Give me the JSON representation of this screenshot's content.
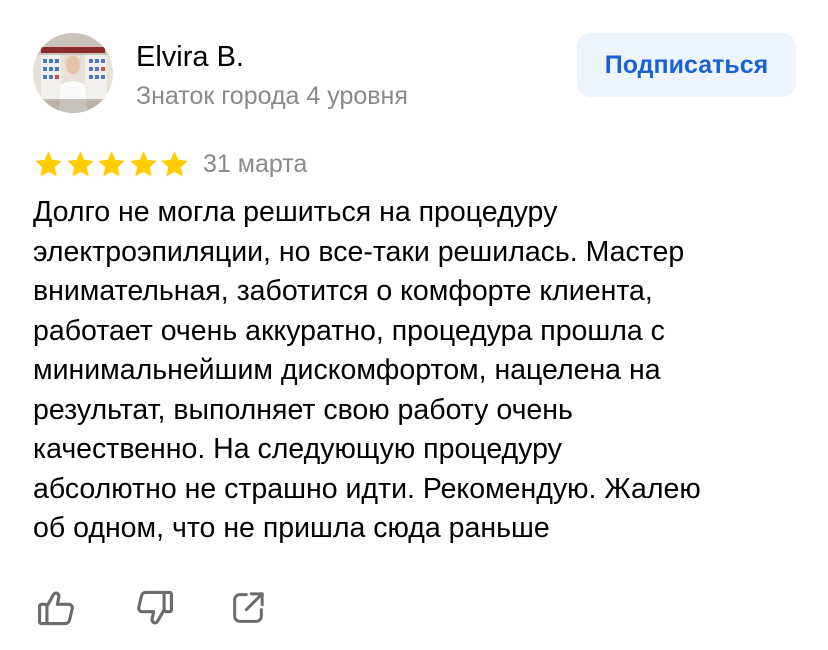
{
  "author": {
    "name": "Elvira B.",
    "level": "Знаток города 4 уровня"
  },
  "subscribe_label": "Подписаться",
  "rating": {
    "value": 5,
    "max": 5,
    "star_color": "#ffcc00"
  },
  "date": "31 марта",
  "review": {
    "lines": [
      "Долго не могла решиться на процедуру",
      "электроэпиляции, но все-таки решилась. Мастер",
      "внимательная, заботится о комфорте клиента,",
      "работает очень аккуратно, процедура прошла с",
      "минимальнейшим дискомфортом, нацелена на",
      "результат, выполняет свою работу очень",
      "качественно. На следующую процедуру",
      "абсолютно не страшно идти. Рекомендую. Жалею",
      "об одном, что не пришла сюда раньше"
    ]
  },
  "actions": {
    "like_icon": "thumbs-up-icon",
    "dislike_icon": "thumbs-down-icon",
    "share_icon": "share-icon"
  },
  "colors": {
    "accent": "#1a62d6",
    "button_bg": "#eef4fc",
    "muted_text": "#8a8a8a",
    "icon": "#6b6b6b"
  }
}
